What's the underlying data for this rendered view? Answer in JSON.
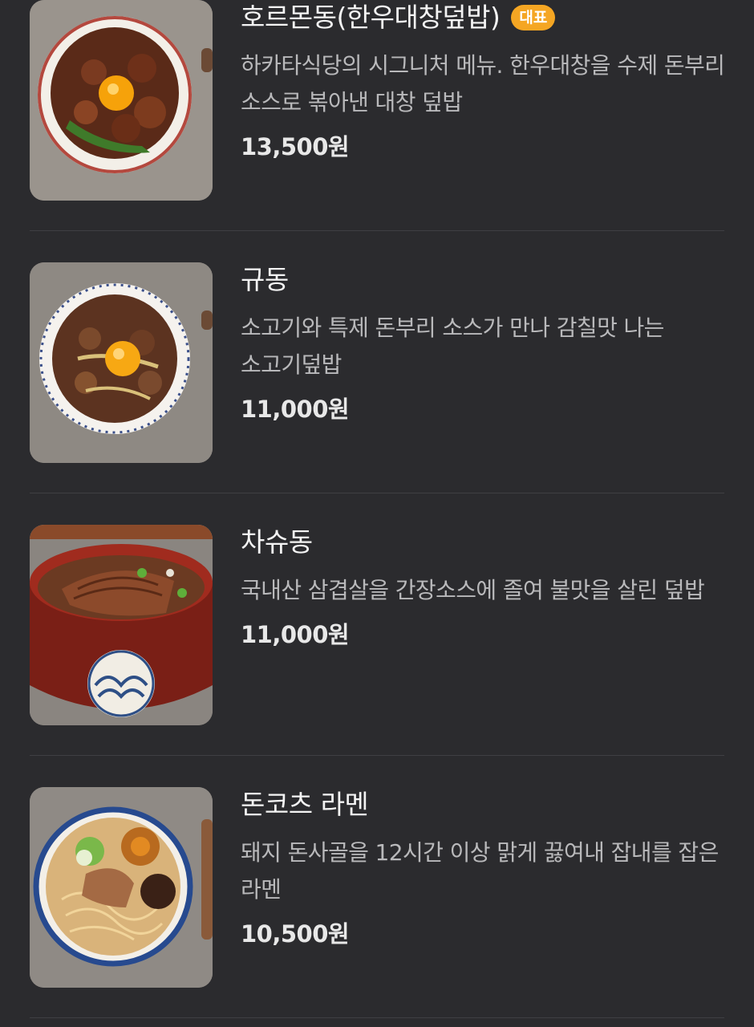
{
  "menu": {
    "items": [
      {
        "name": "호르몬동(한우대창덮밥)",
        "badge": "대표",
        "description": "하카타식당의 시그니처 메뉴. 한우대창을 수제 돈부리 소스로 볶아낸 대창 덮밥",
        "price": "13,500원",
        "image_icon": "hormone-don-photo"
      },
      {
        "name": "규동",
        "badge": "",
        "description": "소고기와 특제 돈부리 소스가 만나 감칠맛 나는 소고기덮밥",
        "price": "11,000원",
        "image_icon": "gyudon-photo"
      },
      {
        "name": "차슈동",
        "badge": "",
        "description": "국내산 삼겹살을 간장소스에 졸여 불맛을 살린 덮밥",
        "price": "11,000원",
        "image_icon": "chashu-don-photo"
      },
      {
        "name": "돈코츠 라멘",
        "badge": "",
        "description": "돼지 돈사골을 12시간 이상 맑게 끓여내 잡내를 잡은 라멘",
        "price": "10,500원",
        "image_icon": "tonkotsu-ramen-photo"
      }
    ]
  },
  "colors": {
    "background": "#2b2b2e",
    "badge": "#f5a623",
    "title": "#f4f4f4",
    "description": "#b9b9bb",
    "price": "#e8e8e8",
    "divider": "#3f3f43"
  }
}
